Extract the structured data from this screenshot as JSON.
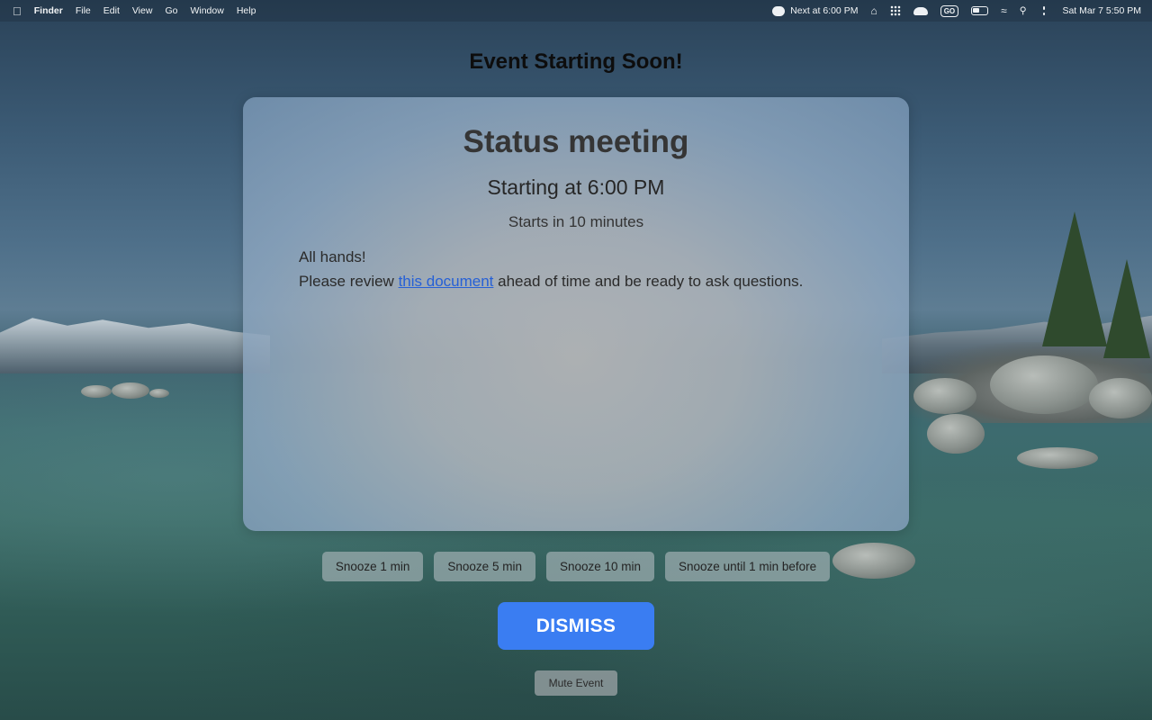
{
  "menubar": {
    "apple_icon": "apple-logo-icon",
    "app_name": "Finder",
    "menus": [
      "File",
      "Edit",
      "View",
      "Go",
      "Window",
      "Help"
    ],
    "next_event": "Next at 6:00 PM",
    "go_badge": "GO",
    "datetime": "Sat Mar 7  5:50 PM"
  },
  "alert": {
    "heading": "Event Starting Soon!",
    "event_title": "Status meeting",
    "start_time": "Starting at 6:00 PM",
    "countdown": "Starts in 10 minutes",
    "notes_line1": "All hands!",
    "notes_line2_prefix": "Please review ",
    "notes_link": "this document",
    "notes_line2_suffix": " ahead of time and be ready to ask questions."
  },
  "snooze_options": [
    {
      "label": "Snooze 1 min"
    },
    {
      "label": "Snooze 5 min"
    },
    {
      "label": "Snooze 10 min"
    },
    {
      "label": "Snooze until 1 min before"
    }
  ],
  "actions": {
    "dismiss_label": "DISMISS",
    "mute_label": "Mute Event"
  },
  "colors": {
    "dismiss_bg": "#3a7df2",
    "link": "#2660d6"
  }
}
